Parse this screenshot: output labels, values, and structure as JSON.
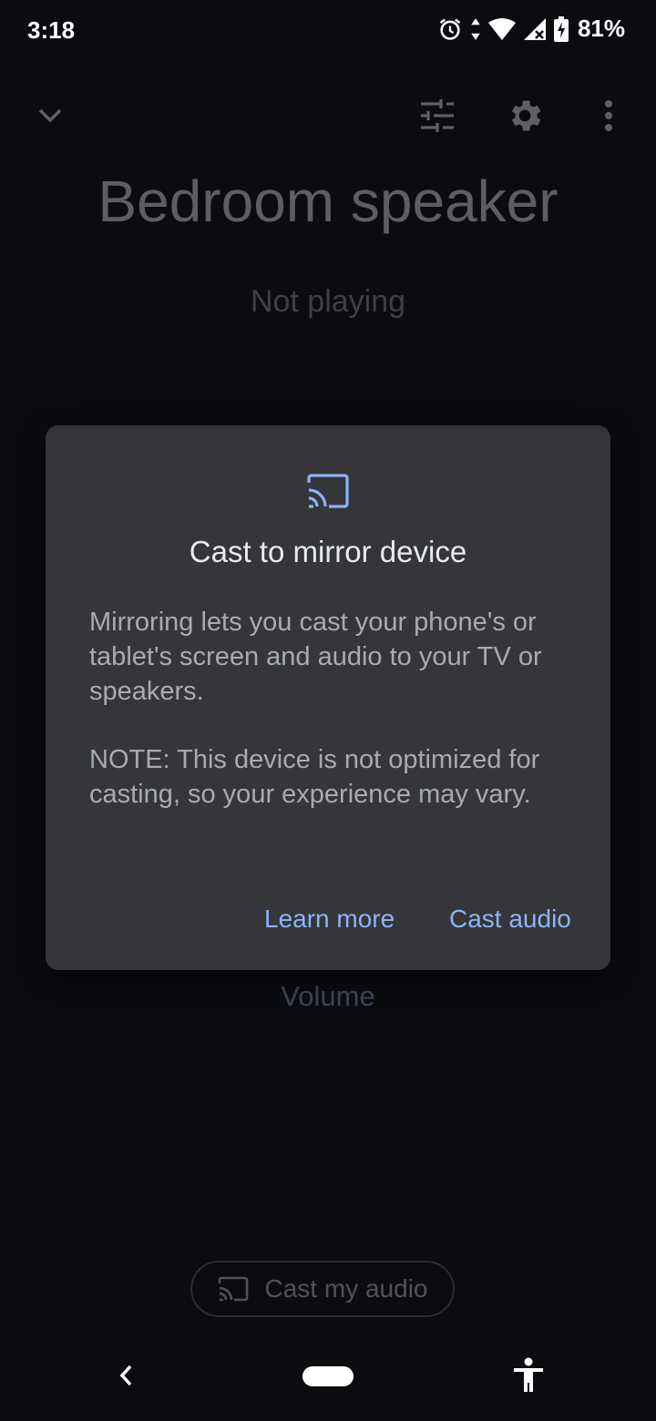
{
  "status_bar": {
    "time": "3:18",
    "battery": "81%",
    "icons": [
      "alarm-icon",
      "data-arrows-icon",
      "wifi-icon",
      "signal-icon",
      "battery-charging-icon"
    ]
  },
  "toolbar": {
    "icons": [
      "chevron-down-icon",
      "equalizer-icon",
      "gear-icon",
      "more-vert-icon"
    ]
  },
  "device": {
    "title": "Bedroom speaker",
    "status": "Not playing"
  },
  "dialog": {
    "icon": "cast-icon",
    "title": "Cast to mirror device",
    "body": "Mirroring lets you cast your phone's or tablet's screen and audio to your TV or speakers.",
    "note": "NOTE: This device is not optimized for casting, so your experience may vary.",
    "learn_more": "Learn more",
    "cast_audio": "Cast audio",
    "accent": "#8ab4f8"
  },
  "volume_label": "Volume",
  "cast_my_audio": "Cast my audio",
  "nav": {
    "icons": [
      "back-icon",
      "home-pill",
      "accessibility-icon"
    ]
  }
}
